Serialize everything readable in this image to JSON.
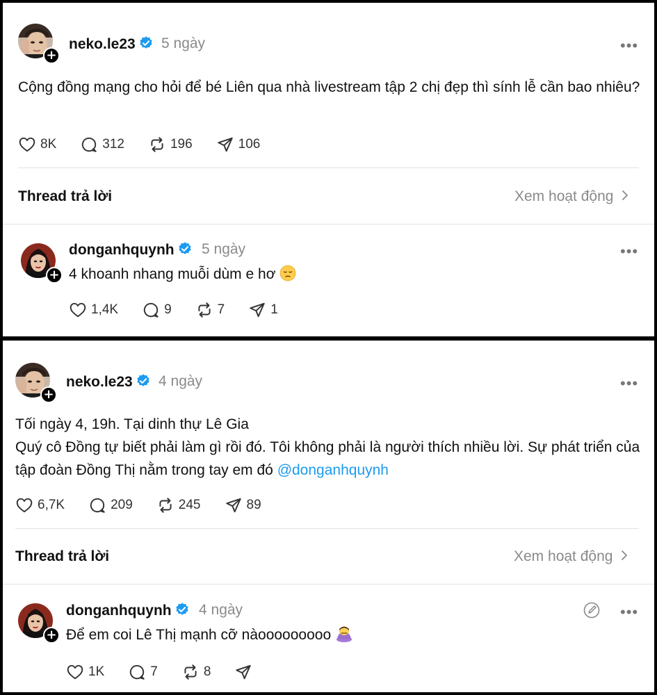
{
  "post1": {
    "username": "neko.le23",
    "time": "5 ngày",
    "text": "Cộng đồng mạng cho hỏi để bé Liên qua nhà livestream tập 2 chị đẹp thì sính lễ cần bao nhiêu?",
    "likes": "8K",
    "comments": "312",
    "reposts": "196",
    "shares": "106",
    "thread_label": "Thread trả lời",
    "view_activity": "Xem hoạt động"
  },
  "reply1": {
    "username": "donganhquynh",
    "time": "5 ngày",
    "text": "4 khoanh nhang muỗi dùm e hơ",
    "likes": "1,4K",
    "comments": "9",
    "reposts": "7",
    "shares": "1"
  },
  "post2": {
    "username": "neko.le23",
    "time": "4 ngày",
    "line1": "Tối ngày 4, 19h. Tại dinh thự Lê Gia",
    "line2": "Quý cô Đồng tự biết phải làm gì rồi đó. Tôi không phải là người thích nhiều lời. Sự phát triển của tập đoàn Đồng Thị nằm trong tay em đó",
    "mention": "@donganhquynh",
    "likes": "6,7K",
    "comments": "209",
    "reposts": "245",
    "shares": "89",
    "thread_label": "Thread trả lời",
    "view_activity": "Xem hoạt động"
  },
  "reply2": {
    "username": "donganhquynh",
    "time": "4 ngày",
    "text": "Để em coi Lê Thị mạnh cỡ nàooooooooo",
    "likes": "1K",
    "comments": "7",
    "reposts": "8",
    "shares": ""
  },
  "icons": {
    "more": "more-dots-icon",
    "like": "heart-icon",
    "comment": "comment-icon",
    "repost": "repost-icon",
    "share": "send-icon",
    "verified": "verified-badge-icon",
    "follow": "plus-icon",
    "edit": "edit-icon"
  },
  "colors": {
    "verified": "#1d9bf0",
    "mention": "#1d9bf0",
    "muted": "#8a8a8a"
  }
}
